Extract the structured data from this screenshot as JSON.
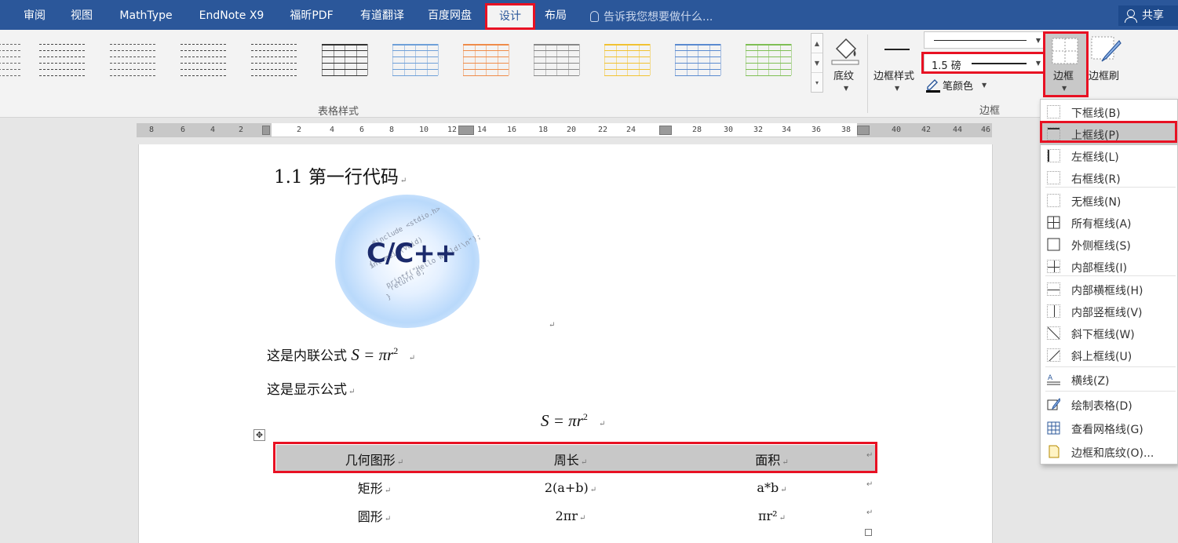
{
  "menubar": {
    "tabs": [
      "审阅",
      "视图",
      "MathType",
      "EndNote X9",
      "福昕PDF",
      "有道翻译",
      "百度网盘",
      "设计",
      "布局"
    ],
    "active_tab": "设计",
    "tell_me_placeholder": "告诉我您想要做什么...",
    "share_label": "共享"
  },
  "ribbon": {
    "table_styles_group_label": "表格样式",
    "shading_label": "底纹",
    "border_styles_label": "边框样式",
    "line_weight_value": "1.5 磅",
    "pen_color_label": "笔颜色",
    "borders_button_label": "边框",
    "border_painter_label": "边框刷",
    "borders_group_label": "边框"
  },
  "ruler": {
    "ticks": [
      "8",
      "6",
      "4",
      "2",
      "2",
      "4",
      "6",
      "8",
      "10",
      "12",
      "14",
      "16",
      "18",
      "20",
      "22",
      "24",
      "28",
      "30",
      "32",
      "34",
      "36",
      "38",
      "40",
      "42",
      "44",
      "46"
    ]
  },
  "document": {
    "heading": "1.1 第一行代码",
    "logo_text": "C/C++",
    "logo_code_lines": [
      "#include <stdio.h>",
      "int main(void)",
      "{",
      "printf(\"Hello World!\\n\");",
      "return 0;",
      "}"
    ],
    "inline_formula_text": "这是内联公式",
    "display_formula_text": "这是显示公式",
    "formula": "S = πr",
    "formula_exponent": "2",
    "table": {
      "headers": [
        "几何图形",
        "周长",
        "面积"
      ],
      "rows": [
        [
          "矩形",
          "2(a+b)",
          "a*b"
        ],
        [
          "圆形",
          "2πr",
          "πr²"
        ]
      ]
    }
  },
  "border_menu": {
    "items": [
      {
        "label": "下框线(B)"
      },
      {
        "label": "上框线(P)"
      },
      {
        "label": "左框线(L)"
      },
      {
        "label": "右框线(R)"
      },
      {
        "label": "无框线(N)"
      },
      {
        "label": "所有框线(A)"
      },
      {
        "label": "外侧框线(S)"
      },
      {
        "label": "内部框线(I)"
      },
      {
        "label": "内部横框线(H)"
      },
      {
        "label": "内部竖框线(V)"
      },
      {
        "label": "斜下框线(W)"
      },
      {
        "label": "斜上框线(U)"
      },
      {
        "label": "横线(Z)"
      },
      {
        "label": "绘制表格(D)"
      },
      {
        "label": "查看网格线(G)"
      },
      {
        "label": "边框和底纹(O)..."
      }
    ],
    "highlighted": "上框线(P)"
  },
  "colors": {
    "title_bar": "#2b579a",
    "highlight_frame": "#e81123",
    "ribbon_bg": "#f3f3f3"
  }
}
